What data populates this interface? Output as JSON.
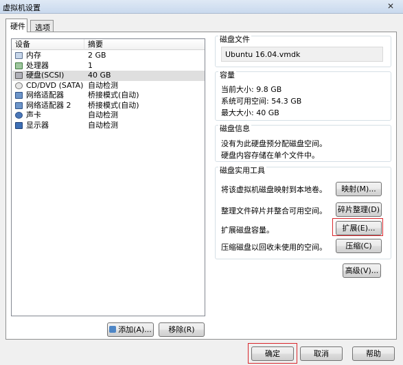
{
  "window": {
    "title": "虚拟机设置",
    "close_glyph": "✕"
  },
  "tabs": [
    {
      "label": "硬件",
      "active": true
    },
    {
      "label": "选项",
      "active": false
    }
  ],
  "device_table": {
    "headers": {
      "device": "设备",
      "summary": "摘要"
    },
    "rows": [
      {
        "name": "内存",
        "summary": "2 GB",
        "icon": "memory-icon"
      },
      {
        "name": "处理器",
        "summary": "1",
        "icon": "cpu-icon"
      },
      {
        "name": "硬盘(SCSI)",
        "summary": "40 GB",
        "icon": "hard-disk-icon",
        "selected": true
      },
      {
        "name": "CD/DVD (SATA)",
        "summary": "自动检测",
        "icon": "cd-dvd-icon"
      },
      {
        "name": "网络适配器",
        "summary": "桥接模式(自动)",
        "icon": "network-adapter-icon"
      },
      {
        "name": "网络适配器 2",
        "summary": "桥接模式(自动)",
        "icon": "network-adapter-icon"
      },
      {
        "name": "声卡",
        "summary": "自动检测",
        "icon": "sound-card-icon"
      },
      {
        "name": "显示器",
        "summary": "自动检测",
        "icon": "display-icon"
      }
    ],
    "add_button": "添加(A)...",
    "remove_button": "移除(R)"
  },
  "disk_file": {
    "title": "磁盘文件",
    "value": "Ubuntu 16.04.vmdk"
  },
  "capacity": {
    "title": "容量",
    "current_size": "当前大小: 9.8 GB",
    "system_free": "系统可用空间: 54.3 GB",
    "max_size": "最大大小: 40 GB"
  },
  "disk_info": {
    "title": "磁盘信息",
    "line1": "没有为此硬盘预分配磁盘空间。",
    "line2": "硬盘内容存储在单个文件中。"
  },
  "disk_utilities": {
    "title": "磁盘实用工具",
    "map_desc": "将该虚拟机磁盘映射到本地卷。",
    "map_button": "映射(M)...",
    "defrag_desc": "整理文件碎片并整合可用空间。",
    "defrag_button": "碎片整理(D)",
    "expand_desc": "扩展磁盘容量。",
    "expand_button": "扩展(E)...",
    "compact_desc": "压缩磁盘以回收未使用的空间。",
    "compact_button": "压缩(C)"
  },
  "advanced_button": "高级(V)...",
  "footer": {
    "ok": "确定",
    "cancel": "取消",
    "help": "帮助"
  },
  "colors": {
    "highlight_box": "#d9252a",
    "selected_row": "#dfdfdf"
  }
}
